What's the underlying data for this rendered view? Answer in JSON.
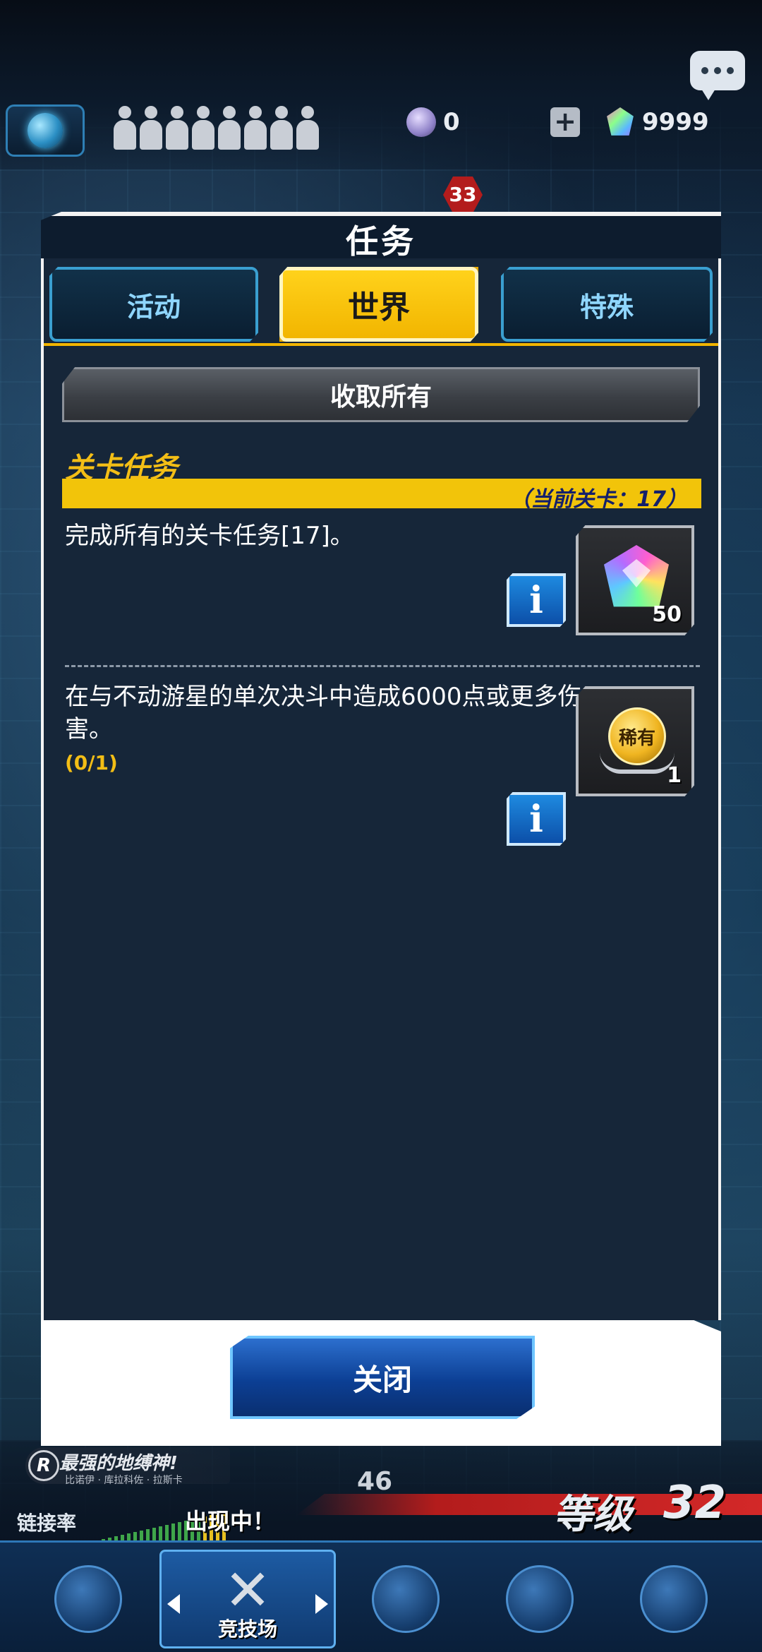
{
  "hud": {
    "orb_count": "0",
    "gem_count": "9999",
    "plus_label": "+",
    "level_badge": "33",
    "chat_icon": "speech-bubble-icon",
    "globe_icon": "globe-icon"
  },
  "modal": {
    "title": "任务",
    "tabs": [
      {
        "label": "活动",
        "active": false
      },
      {
        "label": "世界",
        "active": true
      },
      {
        "label": "特殊",
        "active": false
      }
    ],
    "claim_all_label": "收取所有",
    "section_title": "关卡任务",
    "current_stage": "（当前关卡：17）",
    "missions": [
      {
        "text": "完成所有的关卡任务[17]。",
        "progress": "",
        "reward_icon": "gem-icon",
        "reward_qty": "50",
        "info_label": "i"
      },
      {
        "text": "在与不动游星的单次决斗中造成6000点或更多伤害。",
        "progress": "(0/1)",
        "reward_icon": "rare-medal-icon",
        "reward_badge": "稀有",
        "reward_qty": "1",
        "info_label": "i"
      }
    ],
    "close_label": "关闭"
  },
  "bottom": {
    "banner_title": "最强的地缚神!",
    "banner_sub": "比诺伊 · 库拉科佐 · 拉斯卡",
    "counter": "46",
    "link_rate_label": "链接率",
    "appearing_label": "出现中！",
    "rank_label": "等级",
    "rank_value": "32",
    "nav": [
      {
        "label": "",
        "icon": "duelist-gear-icon"
      },
      {
        "label": "竞技场",
        "icon": "crossed-swords-icon"
      },
      {
        "label": "",
        "icon": "shop-cart-icon"
      },
      {
        "label": "",
        "icon": "cards-icon"
      },
      {
        "label": "",
        "icon": "guild-emblem-icon"
      }
    ]
  }
}
